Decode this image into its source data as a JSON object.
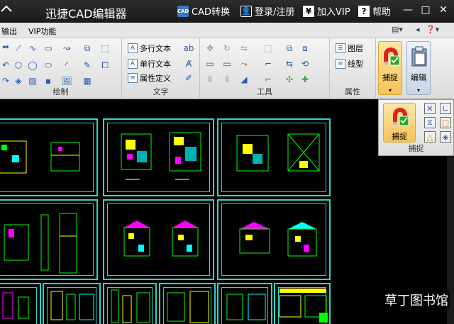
{
  "titlebar": {
    "title": "迅捷CAD编辑器",
    "cad_convert": "CAD转换",
    "login": "登录/注册",
    "vip": "加入VIP",
    "help": "帮助",
    "cad_icon": "CAD",
    "yen_icon": "¥",
    "help_icon": "?"
  },
  "menubar": {
    "items": [
      "输出",
      "VIP功能"
    ]
  },
  "ribbon": {
    "groups": {
      "draw": "绘制",
      "text": "文字",
      "tools": "工具",
      "props": "属性"
    },
    "text_buttons": {
      "multiline": "多行文本",
      "singleline": "单行文本",
      "attr_def": "属性定义"
    },
    "props_buttons": {
      "layer": "图层",
      "linetype": "线型"
    },
    "snap_label": "捕捉",
    "edit_label": "编辑"
  },
  "popup": {
    "snap_label": "捕捉",
    "group_label": "捕捉"
  },
  "watermark": {
    "text": "草丁图书馆"
  },
  "colors": {
    "sheet_border": "#2bd6c9",
    "accent_active": "#f7c35a",
    "canvas_bg": "#000000"
  }
}
